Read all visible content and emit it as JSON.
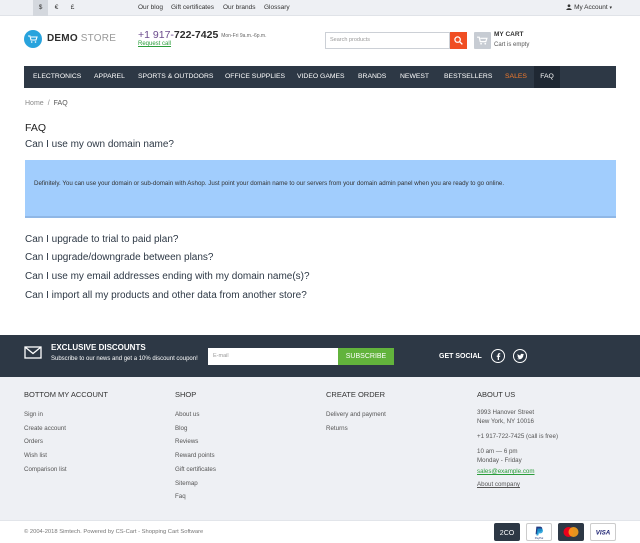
{
  "topbar": {
    "currencies": [
      "$",
      "€",
      "£"
    ],
    "links": [
      "Our blog",
      "Gift certificates",
      "Our brands",
      "Glossary"
    ],
    "account_label": "My Account"
  },
  "header": {
    "logo_bold": "DEMO",
    "logo_light": " STORE",
    "phone_prefix": "+1 917-",
    "phone_main": "722-7425",
    "phone_hours": "Mon-Fri 9a.m.-6p.m.",
    "request_call": "Request call",
    "search_placeholder": "Search products",
    "cart_title": "MY CART",
    "cart_status": "Cart is empty"
  },
  "nav": {
    "items": [
      "ELECTRONICS",
      "APPAREL",
      "SPORTS & OUTDOORS",
      "OFFICE SUPPLIES",
      "VIDEO GAMES",
      "BRANDS",
      "NEWEST",
      "BESTSELLERS",
      "SALES",
      "FAQ"
    ]
  },
  "breadcrumb": {
    "home": "Home",
    "separator": "/",
    "current": "FAQ"
  },
  "faq": {
    "title": "FAQ",
    "expanded_question": "Can I use my own domain name?",
    "expanded_answer": "Definitely. You can use your domain or sub-domain with Ashop. Just point your domain name to our servers from your domain admin panel when you are ready to go online.",
    "questions": [
      "Can I upgrade to trial to paid plan?",
      "Can I upgrade/downgrade between plans?",
      "Can I use my email addresses ending with my domain name(s)?",
      "Can I import all my products and other data from another store?"
    ]
  },
  "subscribe": {
    "title": "EXCLUSIVE DISCOUNTS",
    "text": "Subscribe to our news and get a 10% discount coupon!",
    "email_placeholder": "E-mail",
    "button": "SUBSCRIBE",
    "social_label": "GET SOCIAL"
  },
  "footer": {
    "account": {
      "heading": "BOTTOM MY ACCOUNT",
      "links": [
        "Sign in",
        "Create account",
        "Orders",
        "Wish list",
        "Comparison list"
      ]
    },
    "shop": {
      "heading": "SHOP",
      "links": [
        "About us",
        "Blog",
        "Reviews",
        "Reward points",
        "Gift certificates",
        "Sitemap",
        "Faq"
      ]
    },
    "order": {
      "heading": "CREATE ORDER",
      "links": [
        "Delivery and payment",
        "Returns"
      ]
    },
    "about": {
      "heading": "ABOUT US",
      "address1": "3993 Hanover Street",
      "address2": "New York, NY 10016",
      "phone": "+1 917-722-7425 (call is free)",
      "hours1": "10 am — 6 pm",
      "hours2": "Monday - Friday",
      "email": "sales@example.com",
      "company": "About company"
    },
    "copyright": "© 2004-2018 Simtech.  Powered by CS-Cart - Shopping Cart Software",
    "payments": [
      "2CO",
      "PayPal",
      "MasterCard",
      "VISA"
    ]
  },
  "colors": {
    "nav_bg": "#2d3845",
    "accent_orange": "#f04e23",
    "sales_orange": "#f47a2b",
    "subscribe_green": "#62b33c",
    "answer_bg": "#a1cdfd",
    "logo_blue": "#28a3dd"
  }
}
